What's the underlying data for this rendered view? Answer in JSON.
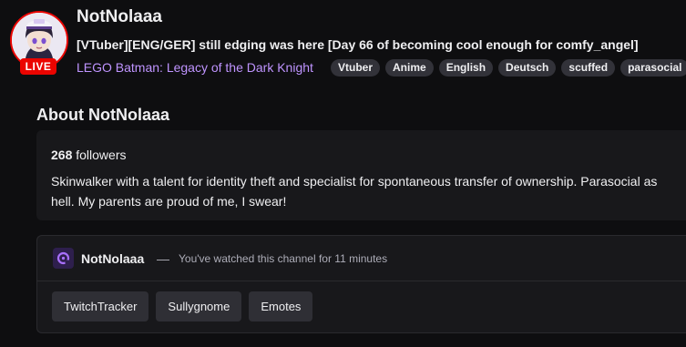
{
  "channel": {
    "name": "NotNolaaa",
    "live_badge": "LIVE",
    "stream_title": "[VTuber][ENG/GER] still edging was here [Day 66 of becoming cool enough for comfy_angel]",
    "game": "LEGO Batman: Legacy of the Dark Knight",
    "tags": [
      "Vtuber",
      "Anime",
      "English",
      "Deutsch",
      "scuffed",
      "parasocial"
    ]
  },
  "about": {
    "heading": "About NotNolaaa",
    "followers_count": "268",
    "followers_label": "followers",
    "bio": "Skinwalker with a talent for identity theft and specialist for spontaneous transfer of ownership. Parasocial as hell. My parents are proud of me, I swear!"
  },
  "extension": {
    "icon": "extension-logo-icon",
    "channel_name": "NotNolaaa",
    "separator": "—",
    "watched_text": "You've watched this channel for 11 minutes",
    "buttons": [
      "TwitchTracker",
      "Sullygnome",
      "Emotes"
    ]
  },
  "colors": {
    "background": "#0e0e10",
    "card": "#18181b",
    "accent": "#bf94ff",
    "live": "#eb0400",
    "tag_bg": "#323239"
  }
}
